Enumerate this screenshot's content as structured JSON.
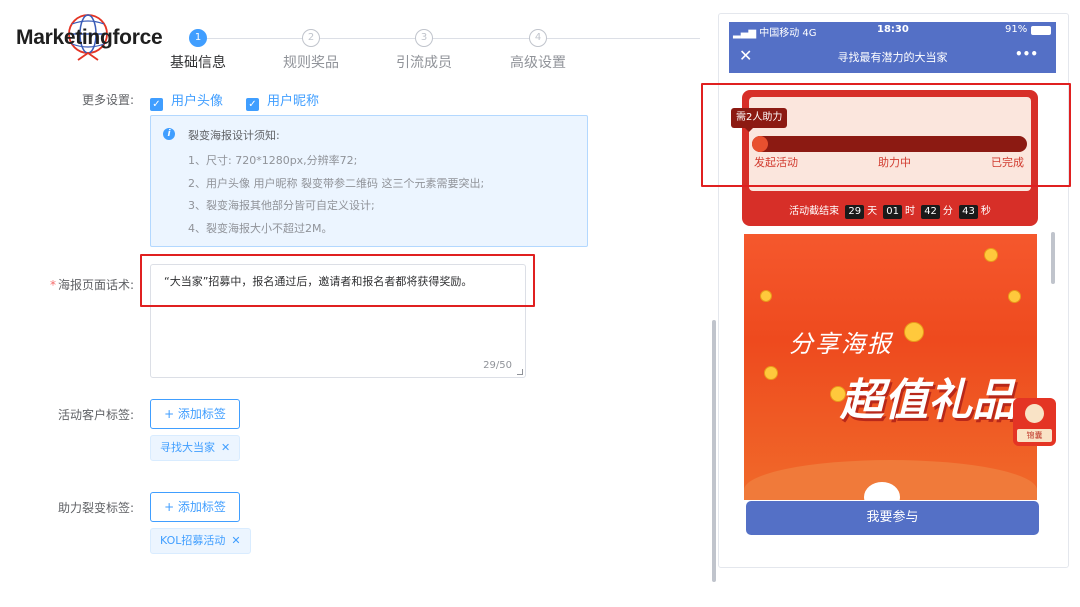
{
  "brand": {
    "name": "Marketingforce"
  },
  "steps": [
    {
      "num": "1",
      "label": "基础信息"
    },
    {
      "num": "2",
      "label": "规则奖品"
    },
    {
      "num": "3",
      "label": "引流成员"
    },
    {
      "num": "4",
      "label": "高级设置"
    }
  ],
  "more_settings": {
    "label": "更多设置:",
    "options": [
      "用户头像",
      "用户昵称"
    ]
  },
  "notice": {
    "title": "裂变海报设计须知:",
    "lines": [
      "1、尺寸: 720*1280px,分辨率72;",
      "2、用户头像 用户昵称 裂变带参二维码 这三个元素需要突出;",
      "3、裂变海报其他部分皆可自定义设计;",
      "4、裂变海报大小不超过2M。"
    ]
  },
  "poster_text": {
    "label": "海报页面话术:",
    "required_mark": "*",
    "value": "“大当家”招募中，报名通过后，邀请者和报名者都将获得奖励。",
    "count": "29/50"
  },
  "customer_tags": {
    "label": "活动客户标签:",
    "add_label": "+ 添加标签",
    "tags": [
      "寻找大当家"
    ]
  },
  "assist_tags": {
    "label": "助力裂变标签:",
    "add_label": "+ 添加标签",
    "tags": [
      "KOL招募活动"
    ]
  },
  "phone": {
    "carrier": "中国移动 4G",
    "time": "18:30",
    "battery": "91%",
    "title": "寻找最有潜力的大当家",
    "close": "✕",
    "more": "•••",
    "badge": "需2人助力",
    "progress_fraction": 0.05,
    "progress_labels": [
      "发起活动",
      "助力中",
      "已完成"
    ],
    "countdown": {
      "prefix": "活动截结束",
      "days": "29",
      "days_unit": "天",
      "hours": "01",
      "hours_unit": "时",
      "minutes": "42",
      "minutes_unit": "分",
      "seconds": "43",
      "seconds_unit": "秒"
    },
    "poster_sub": "分享海报",
    "poster_main": "超值礼品",
    "float_label": "锦囊",
    "join": "我要参与"
  },
  "colors": {
    "primary": "#409eff",
    "phone_bar": "#5470c6",
    "highlight": "#e02020",
    "card_red": "#d72f28"
  }
}
